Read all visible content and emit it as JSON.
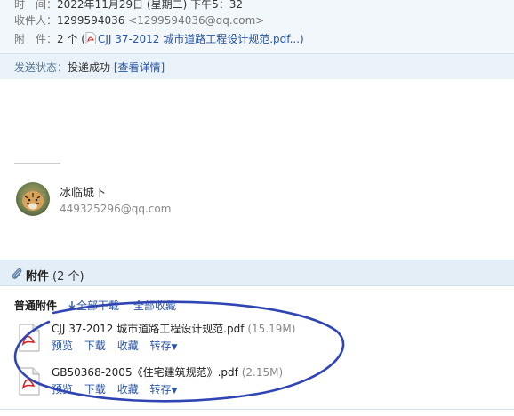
{
  "header": {
    "time_label": "时　间：",
    "time_value": "2022年11月29日 (星期二) 下午5：32",
    "recipient_label": "收件人：",
    "recipient_name": "1299594036",
    "recipient_email": "<1299594036@qq.com>",
    "attach_label": "附　件：",
    "attach_count_text": "2 个 (",
    "attach_file_link": "CJJ 37-2012 城市道路工程设计规范.pdf",
    "attach_suffix": "...)",
    "status_label": "发送状态：",
    "status_value": "投递成功",
    "status_link": "[查看详情]"
  },
  "sender": {
    "name": "冰临城下",
    "email": "449325296@qq.com",
    "avatar": "tiger-avatar"
  },
  "attachments": {
    "title": "附件",
    "count": "(2 个)",
    "kind": "普通附件",
    "download_all": "全部下载",
    "favorite_all": "全部收藏",
    "files": [
      {
        "name": "CJJ 37-2012 城市道路工程设计规范.pdf",
        "size": "(15.19M)",
        "icon": "pdf-file-icon",
        "actions": {
          "preview": "预览",
          "download": "下载",
          "favorite": "收藏",
          "forward": "转存"
        }
      },
      {
        "name": "GB50368-2005《住宅建筑规范》.pdf",
        "size": "(2.15M)",
        "icon": "pdf-file-icon",
        "actions": {
          "preview": "预览",
          "download": "下载",
          "favorite": "收藏",
          "forward": "转存"
        }
      }
    ]
  },
  "colors": {
    "link": "#2a55a6",
    "header_bg": "#f1f7fb",
    "attach_header_bg": "#e4eef6",
    "annotation_ellipse": "#2f45b4"
  }
}
